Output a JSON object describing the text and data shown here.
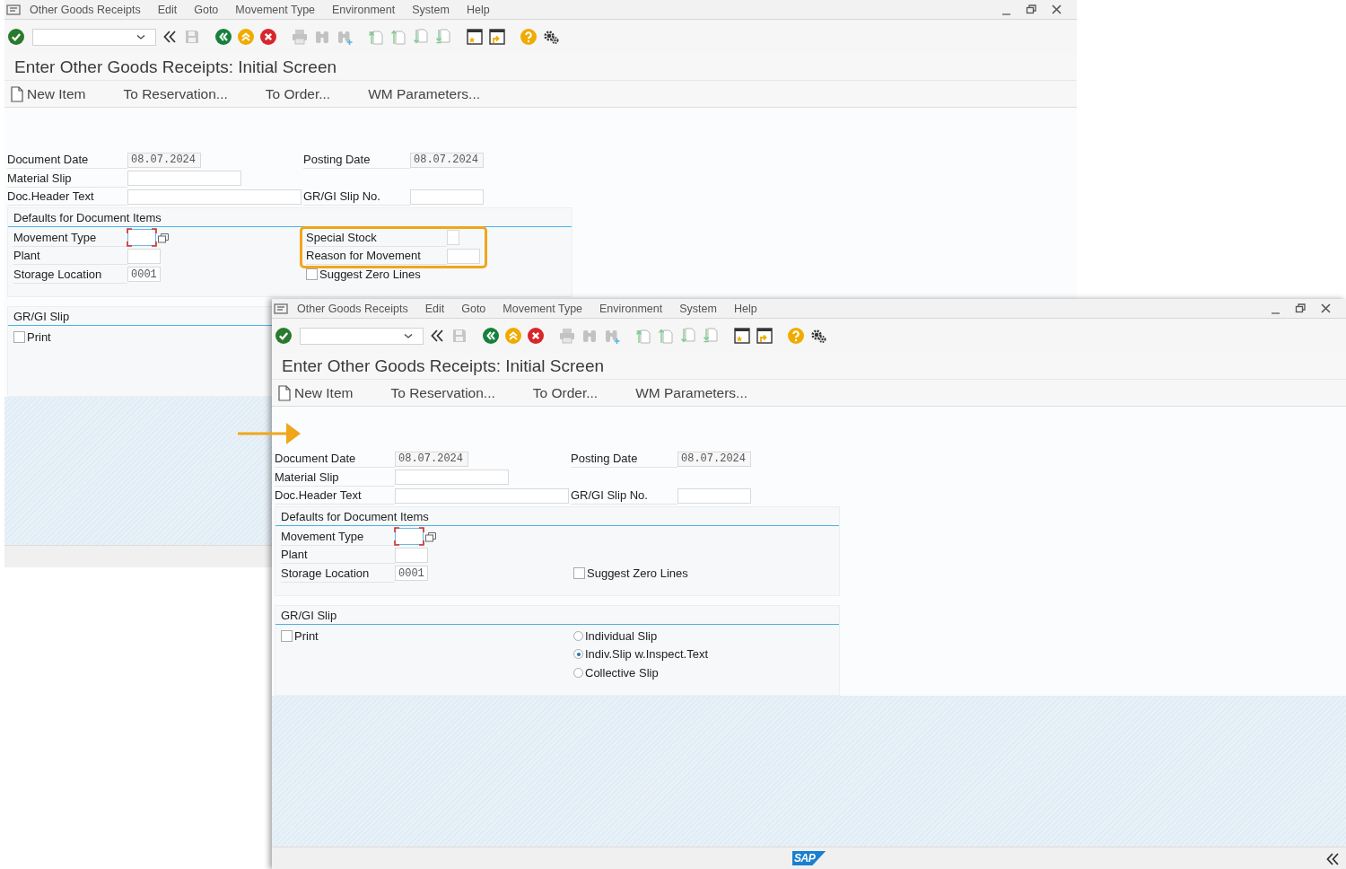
{
  "windows": [
    {
      "menu": [
        "Other Goods Receipts",
        "Edit",
        "Goto",
        "Movement Type",
        "Environment",
        "System",
        "Help"
      ],
      "screen_title": "Enter Other Goods Receipts: Initial Screen",
      "app_toolbar": [
        {
          "label": "New Item",
          "kind": "icon_text"
        },
        {
          "label": "To Reservation...",
          "kind": "text"
        },
        {
          "label": "To Order...",
          "kind": "text"
        },
        {
          "label": "WM Parameters...",
          "kind": "text"
        }
      ],
      "header_rows": [
        {
          "left": {
            "label": "Document Date",
            "kind": "date",
            "value": "08.07.2024"
          },
          "right": {
            "label": "Posting Date",
            "kind": "date",
            "value": "08.07.2024"
          }
        },
        {
          "left": {
            "label": "Material Slip",
            "kind": "medium"
          }
        },
        {
          "left": {
            "label": "Doc.Header Text",
            "kind": "wide"
          },
          "right": {
            "label": "GR/GI Slip No.",
            "kind": "code"
          }
        }
      ],
      "defaults": {
        "title": "Defaults for Document Items",
        "rows": [
          {
            "left": {
              "label": "Movement Type",
              "kind": "required"
            },
            "right": {
              "label": "Special Stock",
              "kind": "tiny",
              "highlighted": true
            }
          },
          {
            "left": {
              "label": "Plant",
              "kind": "code4"
            },
            "right": {
              "label": "Reason for Movement",
              "kind": "code4",
              "highlighted": true
            }
          },
          {
            "left": {
              "label": "Storage Location",
              "kind": "code4",
              "value": "0001"
            },
            "right": {
              "label": "Suggest Zero Lines",
              "kind": "checkbox",
              "checked": false
            }
          }
        ]
      },
      "slip": {
        "title": "GR/GI Slip",
        "print": {
          "label": "Print",
          "checked": false
        }
      }
    },
    {
      "menu": [
        "Other Goods Receipts",
        "Edit",
        "Goto",
        "Movement Type",
        "Environment",
        "System",
        "Help"
      ],
      "screen_title": "Enter Other Goods Receipts: Initial Screen",
      "app_toolbar": [
        {
          "label": "New Item",
          "kind": "icon_text"
        },
        {
          "label": "To Reservation...",
          "kind": "text"
        },
        {
          "label": "To Order...",
          "kind": "text"
        },
        {
          "label": "WM Parameters...",
          "kind": "text"
        }
      ],
      "header_rows": [
        {
          "left": {
            "label": "Document Date",
            "kind": "date",
            "value": "08.07.2024"
          },
          "right": {
            "label": "Posting Date",
            "kind": "date",
            "value": "08.07.2024"
          }
        },
        {
          "left": {
            "label": "Material Slip",
            "kind": "medium"
          }
        },
        {
          "left": {
            "label": "Doc.Header Text",
            "kind": "wide"
          },
          "right": {
            "label": "GR/GI Slip No.",
            "kind": "code"
          }
        }
      ],
      "defaults": {
        "title": "Defaults for Document Items",
        "rows": [
          {
            "left": {
              "label": "Movement Type",
              "kind": "required"
            }
          },
          {
            "left": {
              "label": "Plant",
              "kind": "code4"
            }
          },
          {
            "left": {
              "label": "Storage Location",
              "kind": "code4",
              "value": "0001"
            },
            "right": {
              "label": "Suggest Zero Lines",
              "kind": "checkbox",
              "checked": false
            }
          }
        ]
      },
      "slip": {
        "title": "GR/GI Slip",
        "print": {
          "label": "Print",
          "checked": false
        },
        "options": [
          {
            "label": "Individual Slip",
            "selected": false
          },
          {
            "label": "Indiv.Slip w.Inspect.Text",
            "selected": true
          },
          {
            "label": "Collective Slip",
            "selected": false
          }
        ]
      },
      "status_bar": {
        "logo": "SAP"
      }
    }
  ]
}
